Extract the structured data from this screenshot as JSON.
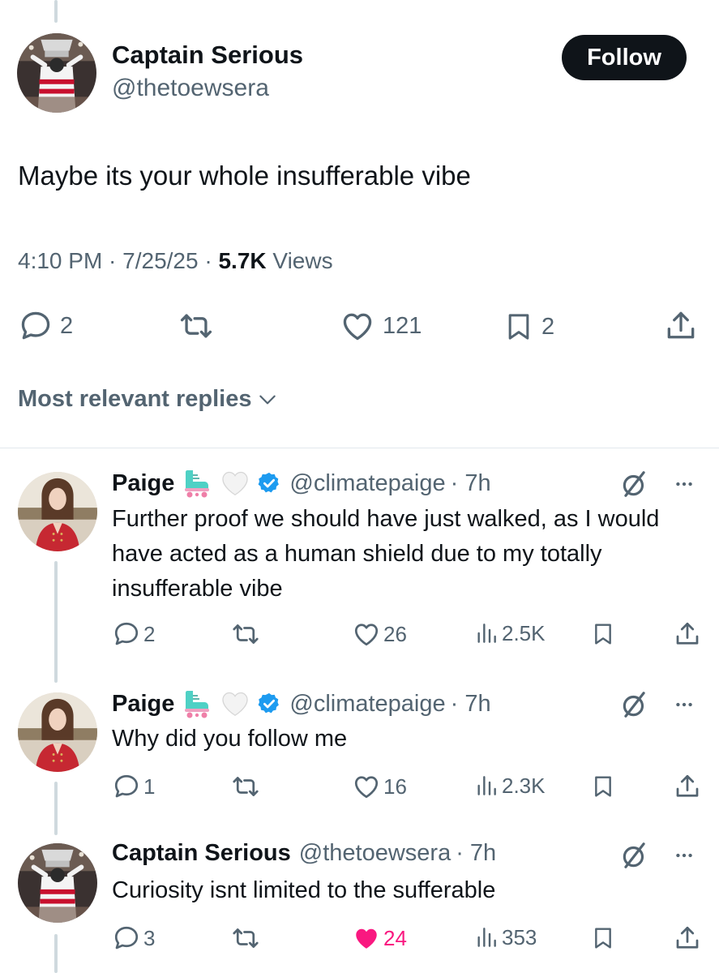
{
  "main_tweet": {
    "display_name": "Captain Serious",
    "handle": "@thetoewsera",
    "follow_label": "Follow",
    "text": "Maybe its your whole insufferable vibe",
    "time": "4:10 PM · 7/25/25 · ",
    "views_count": "5.7K",
    "views_label": " Views",
    "replies": "2",
    "likes": "121",
    "bookmarks": "2"
  },
  "sort": {
    "label": "Most relevant replies"
  },
  "replies": [
    {
      "display_name": "Paige",
      "handle": "@climatepaige",
      "time": "· 7h",
      "text": "Further proof we should have just walked, as I would have acted as a human shield due to my totally insufferable vibe",
      "replies": "2",
      "likes": "26",
      "views": "2.5K",
      "emoji": [
        "roller-skate-icon",
        "white-heart-icon"
      ],
      "verified": true
    },
    {
      "display_name": "Paige",
      "handle": "@climatepaige",
      "time": "· 7h",
      "text": "Why did you follow me",
      "replies": "1",
      "likes": "16",
      "views": "2.3K",
      "emoji": [
        "roller-skate-icon",
        "white-heart-icon"
      ],
      "verified": true
    },
    {
      "display_name": "Captain Serious",
      "handle": "@thetoewsera",
      "time": "· 7h",
      "text": "Curiosity isnt limited to the sufferable",
      "replies": "3",
      "likes": "24",
      "views": "353",
      "liked": true,
      "like_color": "#f91880"
    }
  ],
  "colors": {
    "text": "#0f1419",
    "secondary": "#536471",
    "verified": "#1d9bf0",
    "like": "#f91880",
    "thread": "#cfd9de"
  }
}
